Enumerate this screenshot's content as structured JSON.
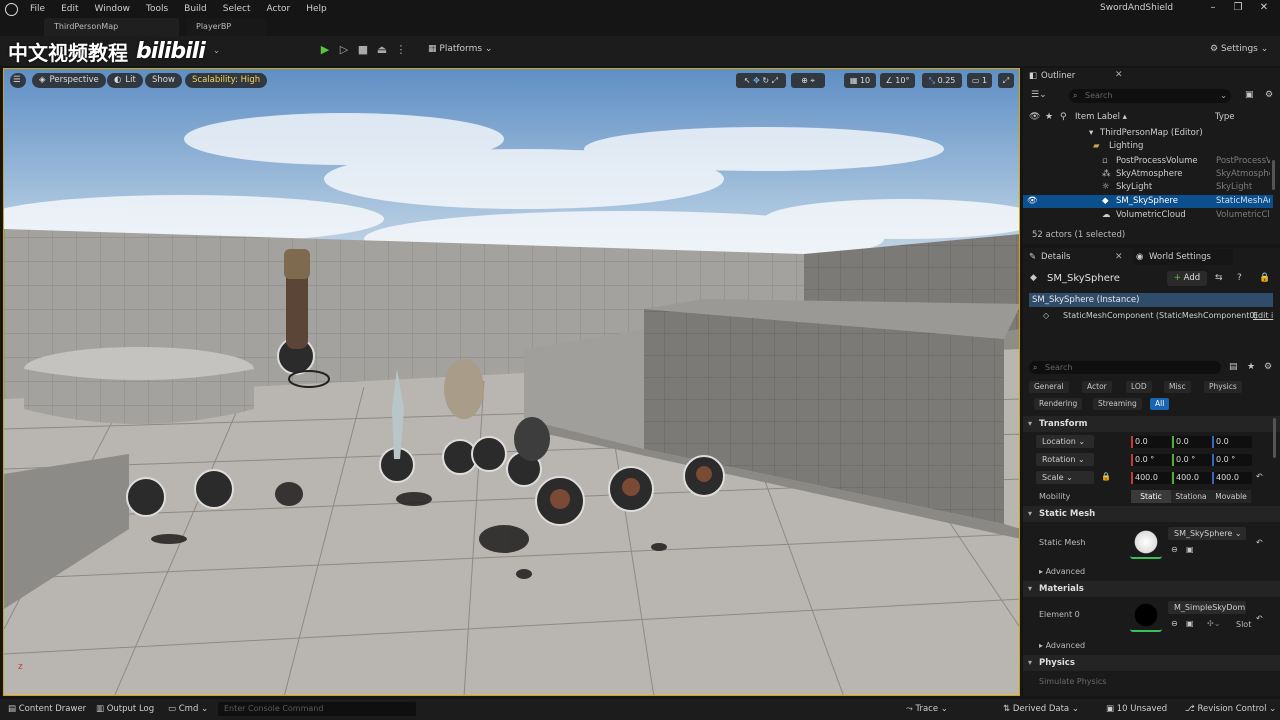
{
  "menu": {
    "items": [
      "File",
      "Edit",
      "Window",
      "Tools",
      "Build",
      "Select",
      "Actor",
      "Help"
    ],
    "project": "SwordAndShield"
  },
  "tabs": {
    "map_tab": "ThirdPersonMap",
    "bp_tab": "PlayerBP"
  },
  "watermark": {
    "cn_text": "中文视频教程",
    "logo_text": "bilibili"
  },
  "toolbar": {
    "platforms": "Platforms",
    "settings": "Settings"
  },
  "viewport": {
    "perspective": "Perspective",
    "lit": "Lit",
    "show": "Show",
    "scalability": "Scalability: High",
    "grid_snap": "10",
    "rot_snap": "10°",
    "scale_snap": "0.25",
    "camera_speed": "1"
  },
  "outliner": {
    "tab": "Outliner",
    "search_placeholder": "Search",
    "col_label": "Item Label ▴",
    "col_type": "Type",
    "rows": [
      {
        "label": "ThirdPersonMap (Editor)",
        "type": ""
      },
      {
        "label": "Lighting",
        "type": ""
      },
      {
        "label": "PostProcessVolume",
        "type": "PostProcessVolume"
      },
      {
        "label": "SkyAtmosphere",
        "type": "SkyAtmosphere"
      },
      {
        "label": "SkyLight",
        "type": "SkyLight"
      },
      {
        "label": "SM_SkySphere",
        "type": "StaticMeshActor"
      },
      {
        "label": "VolumetricCloud",
        "type": "VolumetricCloud"
      }
    ],
    "count": "52 actors (1 selected)"
  },
  "details": {
    "tab": "Details",
    "world_tab": "World Settings",
    "actor_name": "SM_SkySphere",
    "add": "Add",
    "instance": "SM_SkySphere (Instance)",
    "component": "StaticMeshComponent (StaticMeshComponent0)",
    "edit": "Edit i",
    "search_placeholder": "Search",
    "filters": [
      "General",
      "Actor",
      "LOD",
      "Misc",
      "Physics",
      "Rendering",
      "Streaming",
      "All"
    ],
    "transform": {
      "header": "Transform",
      "location_label": "Location",
      "rotation_label": "Rotation",
      "scale_label": "Scale",
      "location": [
        "0.0",
        "0.0",
        "0.0"
      ],
      "rotation": [
        "0.0 °",
        "0.0 °",
        "0.0 °"
      ],
      "scale": [
        "400.0",
        "400.0",
        "400.0"
      ],
      "mobility_label": "Mobility",
      "mobility_options": [
        "Static",
        "Stationa",
        "Movable"
      ]
    },
    "static_mesh": {
      "header": "Static Mesh",
      "label": "Static Mesh",
      "value": "SM_SkySphere",
      "advanced": "Advanced"
    },
    "materials": {
      "header": "Materials",
      "element_label": "Element 0",
      "value": "M_SimpleSkyDom",
      "slot": "Slot",
      "advanced": "Advanced"
    },
    "physics": {
      "header": "Physics",
      "simulate": "Simulate Physics"
    }
  },
  "statusbar": {
    "content_drawer": "Content Drawer",
    "output_log": "Output Log",
    "cmd": "Cmd",
    "console_placeholder": "Enter Console Command",
    "trace": "Trace",
    "derived_data": "Derived Data",
    "unsaved": "10 Unsaved",
    "revision_control": "Revision Control"
  },
  "colors": {
    "accent": "#1765b3",
    "selection": "#0b4f8c",
    "play": "#59c53b",
    "viewport_border": "#d8a600",
    "scalability": "#f5d35a"
  }
}
